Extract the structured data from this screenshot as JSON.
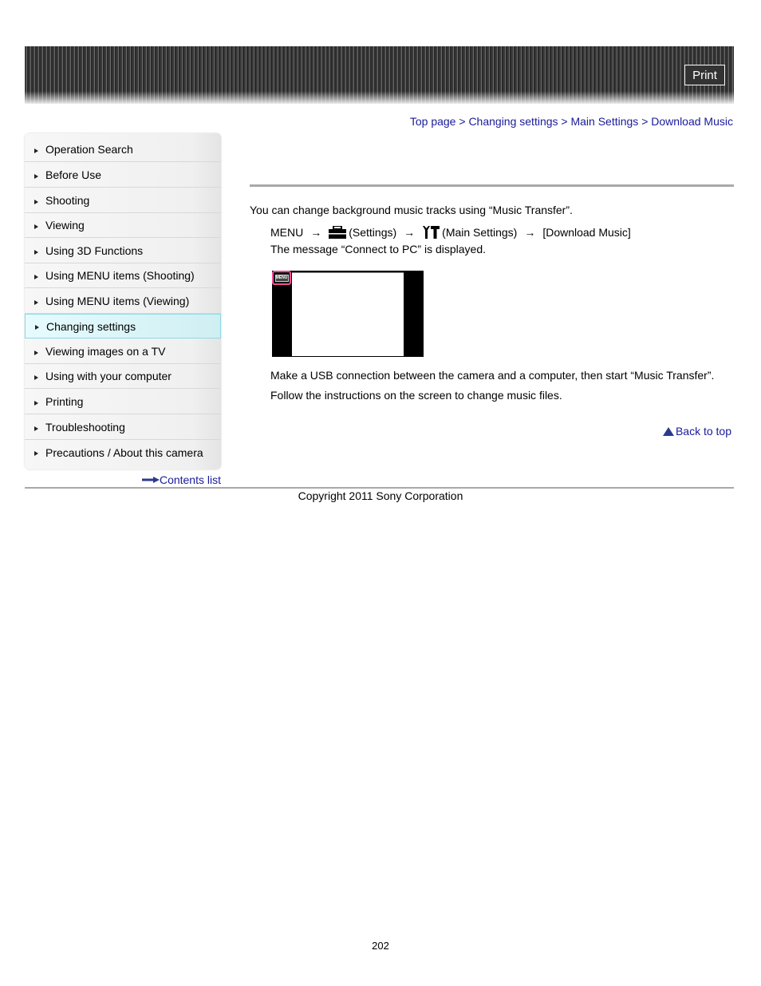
{
  "header": {
    "print_label": "Print"
  },
  "breadcrumb": {
    "items": [
      "Top page",
      "Changing settings",
      "Main Settings",
      "Download Music"
    ],
    "separator": ">"
  },
  "sidebar": {
    "items": [
      {
        "label": "Operation Search"
      },
      {
        "label": "Before Use"
      },
      {
        "label": "Shooting"
      },
      {
        "label": "Viewing"
      },
      {
        "label": "Using 3D Functions"
      },
      {
        "label": "Using MENU items (Shooting)"
      },
      {
        "label": "Using MENU items (Viewing)"
      },
      {
        "label": "Changing settings",
        "active": true
      },
      {
        "label": "Viewing images on a TV"
      },
      {
        "label": "Using with your computer"
      },
      {
        "label": "Printing"
      },
      {
        "label": "Troubleshooting"
      },
      {
        "label": "Precautions / About this camera"
      }
    ],
    "contents_link": "Contents list"
  },
  "main": {
    "intro": "You can change background music tracks using “Music Transfer”.",
    "steps": {
      "menu": "MENU",
      "settings": "(Settings)",
      "main_settings": "(Main Settings)",
      "download_music": "[Download Music]",
      "arrow": "→",
      "settings_icon": "toolbox-icon",
      "main_settings_icon": "wrench-hammer-icon"
    },
    "message": "The message “Connect to PC” is displayed.",
    "screen_menu_label": "MENU",
    "step2": "Make a USB connection between the camera and a computer, then start “Music Transfer”.",
    "step3": "Follow the instructions on the screen to change music files.",
    "back_to_top": "Back to top"
  },
  "footer": {
    "copyright": "Copyright 2011 Sony Corporation",
    "page_number": "202"
  }
}
